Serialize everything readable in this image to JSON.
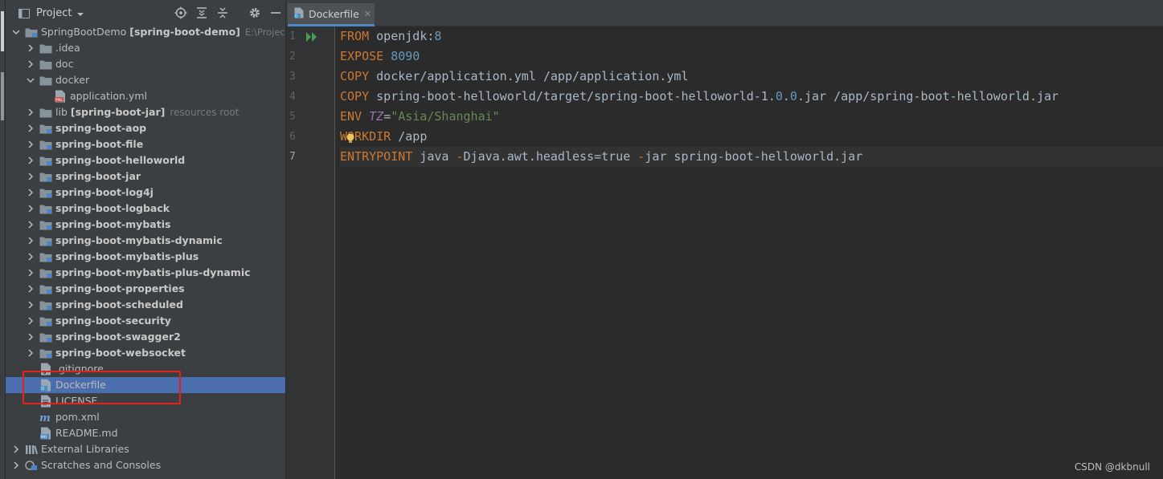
{
  "project_panel": {
    "title": "Project",
    "tree": [
      {
        "name": "SpringBootDemo",
        "module": "[spring-boot-demo]",
        "path": "E:\\Project\\Sp",
        "level": 0,
        "expanded": true,
        "type": "module"
      },
      {
        "name": ".idea",
        "level": 1,
        "expanded": false,
        "type": "folder"
      },
      {
        "name": "doc",
        "level": 1,
        "expanded": false,
        "type": "folder"
      },
      {
        "name": "docker",
        "level": 1,
        "expanded": true,
        "type": "folder"
      },
      {
        "name": "application.yml",
        "level": 2,
        "type": "yml"
      },
      {
        "name": "lib",
        "module": "[spring-boot-jar]",
        "hint": "resources root",
        "level": 1,
        "expanded": false,
        "type": "folder"
      },
      {
        "name": "spring-boot-aop",
        "level": 1,
        "expanded": false,
        "type": "module",
        "bold": true
      },
      {
        "name": "spring-boot-file",
        "level": 1,
        "expanded": false,
        "type": "module",
        "bold": true
      },
      {
        "name": "spring-boot-helloworld",
        "level": 1,
        "expanded": false,
        "type": "module",
        "bold": true
      },
      {
        "name": "spring-boot-jar",
        "level": 1,
        "expanded": false,
        "type": "module",
        "bold": true
      },
      {
        "name": "spring-boot-log4j",
        "level": 1,
        "expanded": false,
        "type": "module",
        "bold": true
      },
      {
        "name": "spring-boot-logback",
        "level": 1,
        "expanded": false,
        "type": "module",
        "bold": true
      },
      {
        "name": "spring-boot-mybatis",
        "level": 1,
        "expanded": false,
        "type": "module",
        "bold": true
      },
      {
        "name": "spring-boot-mybatis-dynamic",
        "level": 1,
        "expanded": false,
        "type": "module",
        "bold": true
      },
      {
        "name": "spring-boot-mybatis-plus",
        "level": 1,
        "expanded": false,
        "type": "module",
        "bold": true
      },
      {
        "name": "spring-boot-mybatis-plus-dynamic",
        "level": 1,
        "expanded": false,
        "type": "module",
        "bold": true
      },
      {
        "name": "spring-boot-properties",
        "level": 1,
        "expanded": false,
        "type": "module",
        "bold": true
      },
      {
        "name": "spring-boot-scheduled",
        "level": 1,
        "expanded": false,
        "type": "module",
        "bold": true
      },
      {
        "name": "spring-boot-security",
        "level": 1,
        "expanded": false,
        "type": "module",
        "bold": true
      },
      {
        "name": "spring-boot-swagger2",
        "level": 1,
        "expanded": false,
        "type": "module",
        "bold": true
      },
      {
        "name": "spring-boot-websocket",
        "level": 1,
        "expanded": false,
        "type": "module",
        "bold": true
      },
      {
        "name": ".gitignore",
        "level": 1,
        "type": "gitignore"
      },
      {
        "name": "Dockerfile",
        "level": 1,
        "type": "dockerfile",
        "selected": true
      },
      {
        "name": "LICENSE",
        "level": 1,
        "type": "text"
      },
      {
        "name": "pom.xml",
        "level": 1,
        "type": "maven"
      },
      {
        "name": "README.md",
        "level": 1,
        "type": "markdown"
      },
      {
        "name": "External Libraries",
        "level": 0,
        "expanded": false,
        "type": "libraries"
      },
      {
        "name": "Scratches and Consoles",
        "level": 0,
        "expanded": false,
        "type": "scratches"
      }
    ]
  },
  "editor": {
    "tab_label": "Dockerfile",
    "current_line": 7,
    "lines": [
      [
        {
          "t": "FROM",
          "c": "kw"
        },
        {
          "t": " openjdk:"
        },
        {
          "t": "8",
          "c": "num"
        }
      ],
      [
        {
          "t": "EXPOSE",
          "c": "kw"
        },
        {
          "t": " "
        },
        {
          "t": "8090",
          "c": "num"
        }
      ],
      [
        {
          "t": "COPY",
          "c": "kw"
        },
        {
          "t": " docker/application.yml /app/application.yml"
        }
      ],
      [
        {
          "t": "COPY",
          "c": "kw"
        },
        {
          "t": " spring-boot-helloworld/target/spring-boot-helloworld-1."
        },
        {
          "t": "0",
          "c": "num"
        },
        {
          "t": "."
        },
        {
          "t": "0",
          "c": "num"
        },
        {
          "t": ".jar /app/spring-boot-helloworld.jar"
        }
      ],
      [
        {
          "t": "ENV",
          "c": "kw"
        },
        {
          "t": " "
        },
        {
          "t": "TZ",
          "c": "var"
        },
        {
          "t": "="
        },
        {
          "t": "\"Asia/Shanghai\"",
          "c": "str"
        }
      ],
      [
        {
          "t": "WORKDIR",
          "c": "kw"
        },
        {
          "t": " /app"
        }
      ],
      [
        {
          "t": "ENTRYPOINT",
          "c": "kw"
        },
        {
          "t": " java "
        },
        {
          "t": "-",
          "c": "kw"
        },
        {
          "t": "Djava.awt.headless=true "
        },
        {
          "t": "-",
          "c": "kw"
        },
        {
          "t": "jar spring-boot-helloworld.jar"
        }
      ]
    ]
  },
  "watermark": "CSDN @dkbnull",
  "colors": {
    "selection": "#4b6eaf",
    "callout": "#e8211d",
    "keyword": "#cc7832",
    "number": "#6897bb",
    "string": "#6a8759",
    "run": "#499c54"
  }
}
